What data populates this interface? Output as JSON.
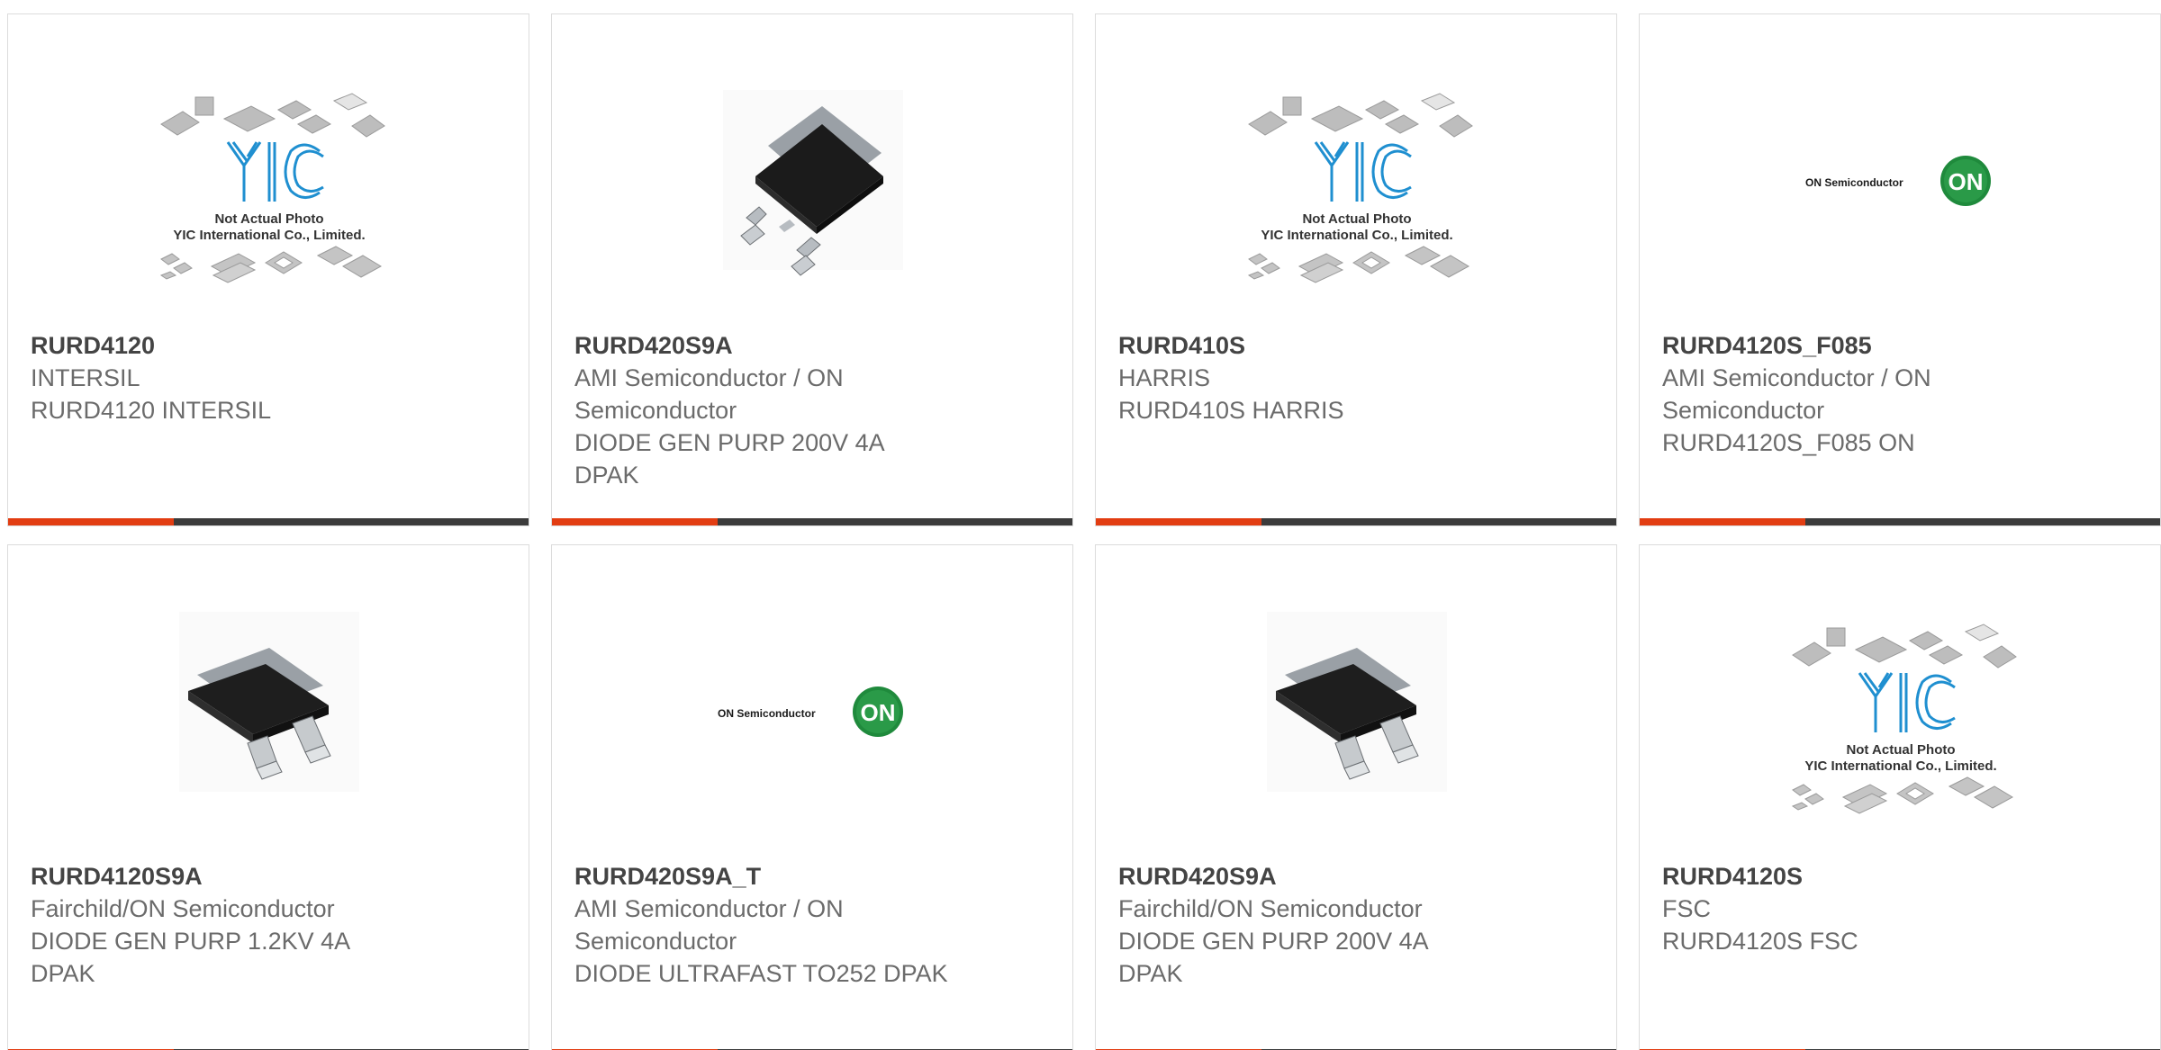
{
  "products": [
    {
      "part_number": "RURD4120",
      "manufacturer": "INTERSIL",
      "description": "RURD4120 INTERSIL",
      "image": "yic-placeholder"
    },
    {
      "part_number": "RURD420S9A",
      "manufacturer": "AMI Semiconductor / ON Semiconductor",
      "description": "DIODE GEN PURP 200V 4A DPAK",
      "image": "dpak-chip"
    },
    {
      "part_number": "RURD410S",
      "manufacturer": "HARRIS",
      "description": "RURD410S HARRIS",
      "image": "yic-placeholder"
    },
    {
      "part_number": "RURD4120S_F085",
      "manufacturer": "AMI Semiconductor / ON Semiconductor",
      "description": "RURD4120S_F085 ON",
      "image": "on-semi-logo"
    },
    {
      "part_number": "RURD4120S9A",
      "manufacturer": "Fairchild/ON Semiconductor",
      "description": "DIODE GEN PURP 1.2KV 4A DPAK",
      "image": "dpak-chip"
    },
    {
      "part_number": "RURD420S9A_T",
      "manufacturer": "AMI Semiconductor / ON Semiconductor",
      "description": "DIODE ULTRAFAST TO252 DPAK",
      "image": "on-semi-logo"
    },
    {
      "part_number": "RURD420S9A",
      "manufacturer": "Fairchild/ON Semiconductor",
      "description": "DIODE GEN PURP 200V 4A DPAK",
      "image": "dpak-chip"
    },
    {
      "part_number": "RURD4120S",
      "manufacturer": "FSC",
      "description": "RURD4120S FSC",
      "image": "yic-placeholder"
    }
  ],
  "placeholder": {
    "line1": "Not Actual Photo",
    "line2": "YIC International Co., Limited.",
    "logo_text": "YIC"
  },
  "on_logo": {
    "wordmark": "ON Semiconductor",
    "badge": "ON"
  },
  "colors": {
    "accent": "#e23d12",
    "bar": "#3b3b3b",
    "on_green": "#1f8a3c",
    "yic_blue": "#1f8fd0"
  }
}
